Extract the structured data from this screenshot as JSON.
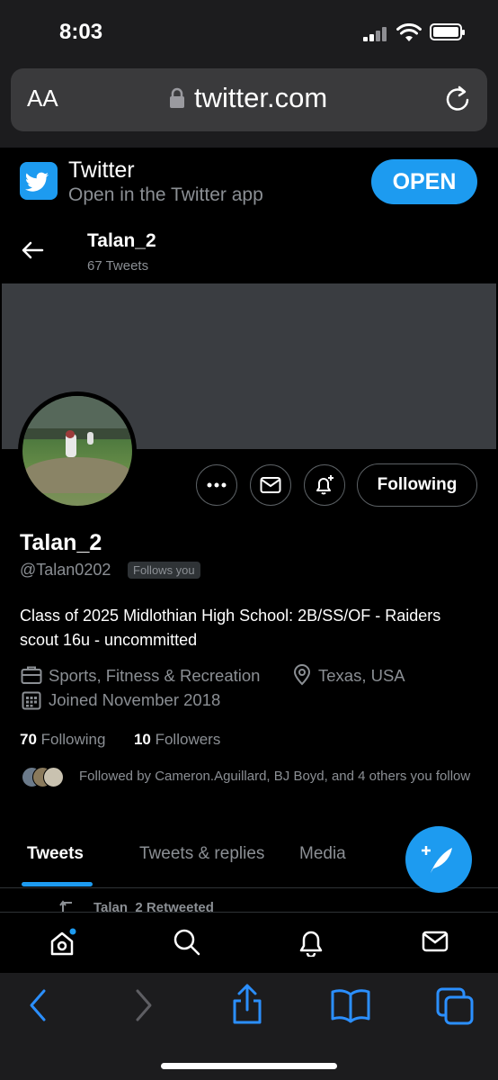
{
  "status_bar": {
    "time": "8:03"
  },
  "safari": {
    "text_size_label": "AA",
    "url": "twitter.com",
    "icons": [
      "lock-icon",
      "reload-icon",
      "back-icon",
      "forward-icon",
      "share-icon",
      "bookmarks-icon",
      "tabs-icon"
    ]
  },
  "app_banner": {
    "title": "Twitter",
    "subtitle": "Open in the Twitter app",
    "open_label": "OPEN"
  },
  "profile_header": {
    "name": "Talan_2",
    "tweet_count": "67 Tweets"
  },
  "profile": {
    "display_name": "Talan_2",
    "handle": "@Talan0202",
    "follows_you": "Follows you",
    "bio": "Class of 2025 Midlothian High School: 2B/SS/OF - Raiders scout 16u - uncommitted",
    "category": "Sports, Fitness & Recreation",
    "location": "Texas, USA",
    "joined": "Joined November 2018",
    "following_count": "70",
    "following_label": "Following",
    "followers_count": "10",
    "followers_label": "Followers",
    "followed_by": "Followed by Cameron.Aguillard, BJ Boyd, and 4 others you follow",
    "following_button": "Following"
  },
  "tabs": [
    {
      "label": "Tweets",
      "active": true
    },
    {
      "label": "Tweets & replies",
      "active": false
    },
    {
      "label": "Media",
      "active": false
    }
  ],
  "timeline": {
    "retweet_hint": "Talan_2 Retweeted"
  },
  "colors": {
    "accent": "#1d9bf0",
    "background": "#000000",
    "secondary_text": "#8b8f94"
  }
}
